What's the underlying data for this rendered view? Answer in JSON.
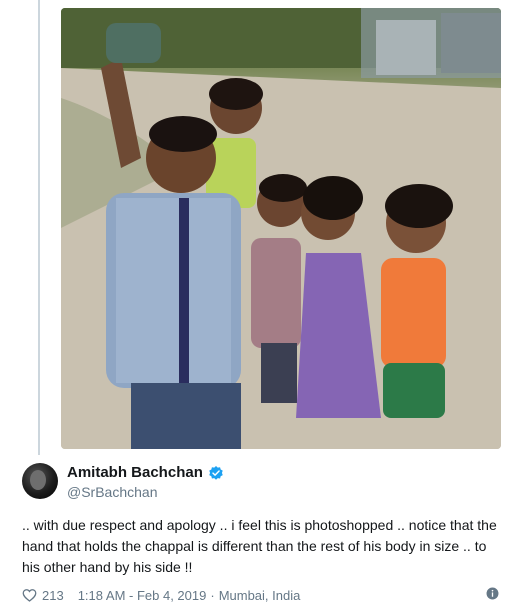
{
  "tweet": {
    "author_name": "Amitabh Bachchan",
    "author_handle": "@SrBachchan",
    "text": ".. with due respect and apology .. i feel this is photoshopped .. notice that the hand that holds the chappal is different than the rest of his body in size  .. to his other hand by his side !!",
    "likes": "213",
    "timestamp": "1:18 AM - Feb 4, 2019",
    "separator": "·",
    "location": "Mumbai, India",
    "icons": {
      "like": "heart-icon",
      "verified": "verified-badge-icon",
      "info": "info-icon"
    },
    "colors": {
      "verified": "#1da1f2",
      "meta": "#657786",
      "text": "#14171a"
    }
  }
}
